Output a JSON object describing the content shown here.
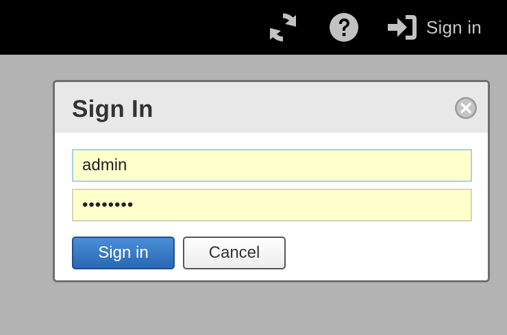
{
  "topbar": {
    "refresh_icon": "refresh-icon",
    "help_icon": "question-circle-icon",
    "signin_icon": "sign-in-icon",
    "signin_label": "Sign in"
  },
  "dialog": {
    "title": "Sign In",
    "close_icon": "close-circle-icon",
    "username": {
      "value": "admin"
    },
    "password": {
      "value": "••••••••"
    },
    "signin_button": "Sign in",
    "cancel_button": "Cancel"
  },
  "colors": {
    "topbar_bg": "#000000",
    "overlay_bg": "#b3b3b3",
    "header_bg": "#e8e8e8",
    "field_bg": "#ffffcc",
    "primary_button": "#2a67b5"
  }
}
